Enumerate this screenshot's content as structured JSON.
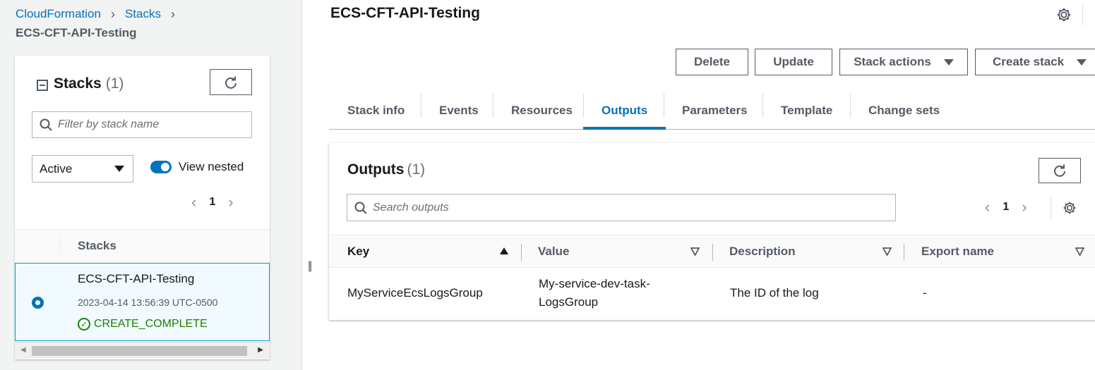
{
  "breadcrumb": {
    "items": [
      "CloudFormation",
      "Stacks"
    ],
    "current": "ECS-CFT-API-Testing"
  },
  "stacks_panel": {
    "title": "Stacks",
    "count": "(1)",
    "filter_placeholder": "Filter by stack name",
    "status_filter": "Active",
    "view_nested_label": "View nested",
    "view_nested_on": true,
    "page": "1",
    "column_header": "Stacks",
    "rows": [
      {
        "name": "ECS-CFT-API-Testing",
        "created": "2023-04-14 13:56:39 UTC-0500",
        "status": "CREATE_COMPLETE",
        "selected": true
      }
    ]
  },
  "main": {
    "title": "ECS-CFT-API-Testing",
    "buttons": {
      "delete": "Delete",
      "update": "Update",
      "stack_actions": "Stack actions",
      "create_stack": "Create stack"
    },
    "tabs": [
      {
        "label": "Stack info"
      },
      {
        "label": "Events"
      },
      {
        "label": "Resources"
      },
      {
        "label": "Outputs",
        "active": true
      },
      {
        "label": "Parameters"
      },
      {
        "label": "Template"
      },
      {
        "label": "Change sets"
      }
    ],
    "outputs": {
      "title": "Outputs",
      "count": "(1)",
      "search_placeholder": "Search outputs",
      "page": "1",
      "columns": [
        "Key",
        "Value",
        "Description",
        "Export name"
      ],
      "rows": [
        {
          "key": "MyServiceEcsLogsGroup",
          "value_line1": "My-service-dev-task-",
          "value_line2": "LogsGroup",
          "description": "The ID of the log",
          "export_name": "-"
        }
      ]
    }
  },
  "colors": {
    "link": "#0073bb",
    "success": "#1d8102",
    "text": "#16191f",
    "muted": "#545b64"
  }
}
